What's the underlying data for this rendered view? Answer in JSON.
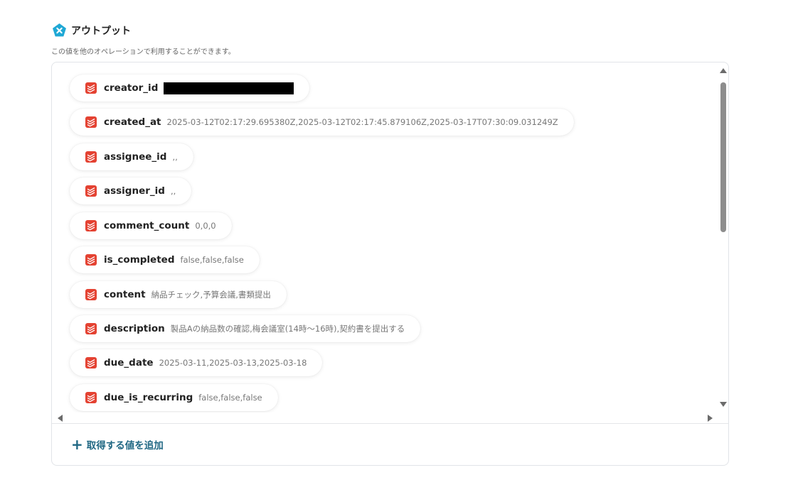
{
  "header": {
    "title": "アウトプット",
    "subtitle": "この値を他のオペレーションで利用することができます。",
    "icon": "yoom-operation-icon"
  },
  "outputs": [
    {
      "name": "creator_id",
      "value": "",
      "redacted": true
    },
    {
      "name": "created_at",
      "value": "2025-03-12T02:17:29.695380Z,2025-03-12T02:17:45.879106Z,2025-03-17T07:30:09.031249Z"
    },
    {
      "name": "assignee_id",
      "value": ",,"
    },
    {
      "name": "assigner_id",
      "value": ",,"
    },
    {
      "name": "comment_count",
      "value": "0,0,0"
    },
    {
      "name": "is_completed",
      "value": "false,false,false"
    },
    {
      "name": "content",
      "value": "納品チェック,予算会議,書類提出"
    },
    {
      "name": "description",
      "value": "製品Aの納品数の確認,梅会議室(14時〜16時),契約書を提出する"
    },
    {
      "name": "due_date",
      "value": "2025-03-11,2025-03-13,2025-03-18"
    },
    {
      "name": "due_is_recurring",
      "value": "false,false,false"
    }
  ],
  "footer": {
    "add_label": "取得する値を追加",
    "add_icon": "plus-icon"
  },
  "colors": {
    "accent": "#1f6783",
    "todoist_red": "#e44232",
    "header_icon": "#1fa8d5"
  }
}
